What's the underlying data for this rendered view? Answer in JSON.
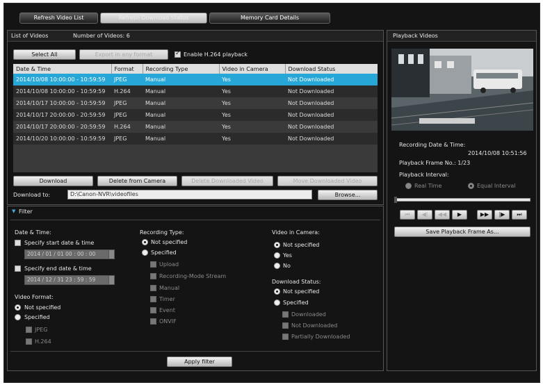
{
  "toolbar": {
    "refresh_video_list": "Refresh Video List",
    "refresh_download_status": "Refresh Download Status",
    "memory_card_details": "Memory Card Details"
  },
  "list_panel": {
    "title": "List of Videos",
    "count_label": "Number of Videos: 6",
    "select_all": "Select All",
    "export_any_format": "Export in any format",
    "enable_h264_label": "Enable H.264 playback",
    "enable_h264_checked": true,
    "columns": [
      "Date & Time",
      "Format",
      "Recording Type",
      "Video in Camera",
      "Download Status"
    ],
    "rows": [
      [
        "2014/10/08 10:00:00 - 10:59:59",
        "JPEG",
        "Manual",
        "Yes",
        "Not Downloaded"
      ],
      [
        "2014/10/08 10:00:00 - 10:59:59",
        "H.264",
        "Manual",
        "Yes",
        "Not Downloaded"
      ],
      [
        "2014/10/17 10:00:00 - 10:59:59",
        "JPEG",
        "Manual",
        "Yes",
        "Not Downloaded"
      ],
      [
        "2014/10/17 20:00:00 - 20:59:59",
        "JPEG",
        "Manual",
        "Yes",
        "Not Downloaded"
      ],
      [
        "2014/10/17 20:00:00 - 20:59:59",
        "H.264",
        "Manual",
        "Yes",
        "Not Downloaded"
      ],
      [
        "2014/10/20 10:00:00 - 10:59:59",
        "JPEG",
        "Manual",
        "Yes",
        "Not Downloaded"
      ]
    ],
    "download": "Download",
    "delete_from_camera": "Delete from Camera",
    "delete_downloaded_video": "Delete Downloaded Video",
    "move_downloaded_video": "Move Downloaded Video",
    "download_to_label": "Download to:",
    "download_to_value": "D:\\Canon-NVR\\videofiles",
    "browse": "Browse..."
  },
  "filter": {
    "title": "Filter",
    "date_time_label": "Date & Time:",
    "specify_start_label": "Specify start date & time",
    "start_value": "2014 / 01 / 01  00 : 00 : 00",
    "specify_end_label": "Specify end date & time",
    "end_value": "2014 / 12 / 31  23 : 59 : 59",
    "video_format_label": "Video Format:",
    "vf_not_specified": "Not specified",
    "vf_specified": "Specified",
    "vf_jpeg": "JPEG",
    "vf_h264": "H.264",
    "recording_type_label": "Recording Type:",
    "rt_not_specified": "Not specified",
    "rt_specified": "Specified",
    "rt_upload": "Upload",
    "rt_recording_mode_stream": "Recording-Mode Stream",
    "rt_manual": "Manual",
    "rt_timer": "Timer",
    "rt_event": "Event",
    "rt_onvif": "ONVIF",
    "video_in_camera_label": "Video in Camera:",
    "vic_not_specified": "Not specified",
    "vic_yes": "Yes",
    "vic_no": "No",
    "download_status_label": "Download Status:",
    "ds_not_specified": "Not specified",
    "ds_specified": "Specified",
    "ds_downloaded": "Downloaded",
    "ds_not_downloaded": "Not Downloaded",
    "ds_partially_downloaded": "Partially Downloaded",
    "apply_filter": "Apply filter"
  },
  "playback": {
    "title": "Playback Videos",
    "recording_datetime_label": "Recording Date & Time:",
    "recording_datetime_value": "2014/10/08 10:51:56",
    "frame_no": "Playback Frame No.: 1/23",
    "interval_label": "Playback Interval:",
    "real_time": "Real Time",
    "equal_interval": "Equal Interval",
    "progress": 0.0,
    "save_frame": "Save Playback Frame As..."
  }
}
